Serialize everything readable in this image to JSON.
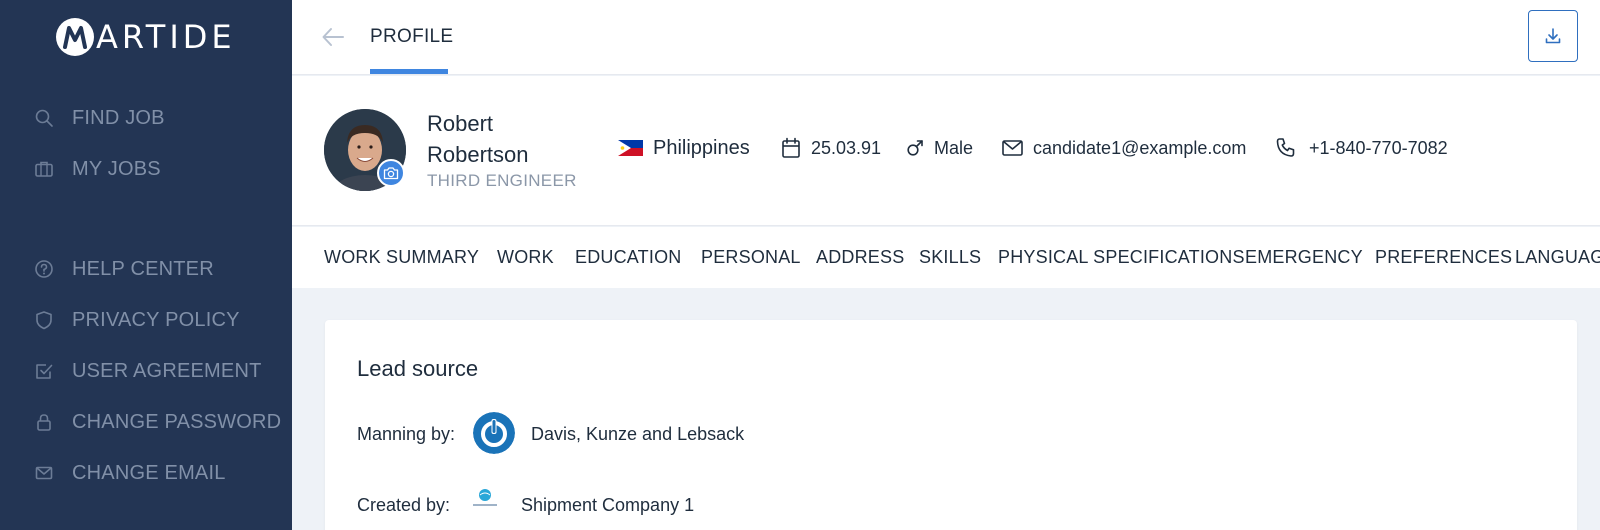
{
  "brand": {
    "logo_text": "ARTIDE",
    "logo_letter": "M"
  },
  "sidebar": {
    "items": [
      {
        "label": "FIND JOB",
        "icon": "search-icon"
      },
      {
        "label": "MY JOBS",
        "icon": "briefcase-icon"
      },
      {
        "label": "HELP CENTER",
        "icon": "help-circle-icon"
      },
      {
        "label": "PRIVACY POLICY",
        "icon": "shield-icon"
      },
      {
        "label": "USER AGREEMENT",
        "icon": "checkbox-icon"
      },
      {
        "label": "CHANGE PASSWORD",
        "icon": "lock-icon"
      },
      {
        "label": "CHANGE EMAIL",
        "icon": "mail-icon"
      }
    ]
  },
  "header": {
    "title": "PROFILE",
    "back_icon": "arrow-left-icon",
    "download_icon": "download-icon"
  },
  "profile": {
    "first_name": "Robert",
    "last_name": "Robertson",
    "rank": "THIRD ENGINEER",
    "country": "Philippines",
    "birth_date": "25.03.91",
    "gender": "Male",
    "email": "candidate1@example.com",
    "phone": "+1-840-770-7082"
  },
  "tabs": [
    "WORK SUMMARY",
    "WORK",
    "EDUCATION",
    "PERSONAL",
    "ADDRESS",
    "SKILLS",
    "PHYSICAL SPECIFICATIONS",
    "EMERGENCY",
    "PREFERENCES",
    "LANGUAG"
  ],
  "lead_source": {
    "title": "Lead source",
    "manning_label": "Manning by:",
    "manning_value": "Davis, Kunze and Lebsack",
    "created_label": "Created by:",
    "created_value": "Shipment Company 1"
  },
  "colors": {
    "sidebar_bg": "#233554",
    "accent": "#3f86e0",
    "nav_text": "#8190a8"
  }
}
